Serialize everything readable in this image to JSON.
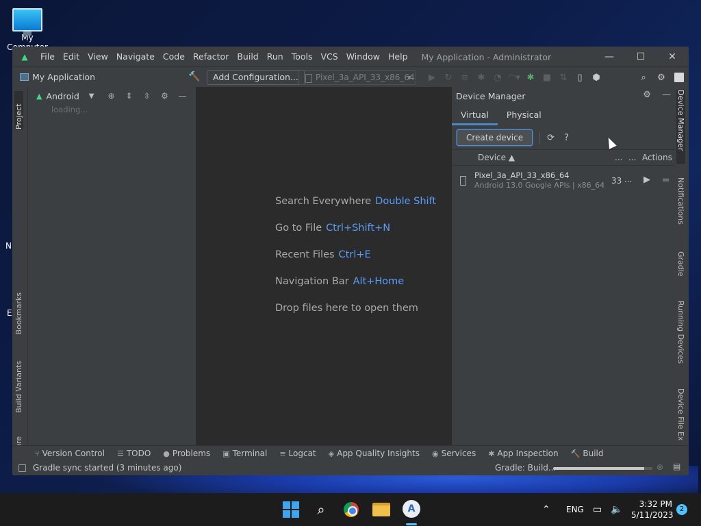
{
  "desktop": {
    "icon_label": "My Computer",
    "partial_labels": [
      "N",
      "E"
    ]
  },
  "window": {
    "title": "My Application - Administrator",
    "menu": [
      "File",
      "Edit",
      "View",
      "Navigate",
      "Code",
      "Refactor",
      "Build",
      "Run",
      "Tools",
      "VCS",
      "Window",
      "Help"
    ],
    "controls": {
      "minimize": "—",
      "maximize": "☐",
      "close": "✕"
    }
  },
  "toolbar": {
    "project_name": "My Application",
    "add_config_label": "Add Configuration...",
    "device_selector": "Pixel_3a_API_33_x86_64"
  },
  "left_tabs": [
    "Project",
    "Bookmarks",
    "Build Variants",
    "Structure"
  ],
  "project_panel": {
    "view_mode": "Android",
    "loading_text": "loading..."
  },
  "editor_hints": [
    {
      "label": "Search Everywhere",
      "key": "Double Shift"
    },
    {
      "label": "Go to File",
      "key": "Ctrl+Shift+N"
    },
    {
      "label": "Recent Files",
      "key": "Ctrl+E"
    },
    {
      "label": "Navigation Bar",
      "key": "Alt+Home"
    },
    {
      "label": "Drop files here to open them",
      "key": ""
    }
  ],
  "device_manager": {
    "title": "Device Manager",
    "tabs": [
      "Virtual",
      "Physical"
    ],
    "active_tab": "Virtual",
    "create_button": "Create device",
    "columns": {
      "device": "Device",
      "api": "...",
      "size": "...",
      "actions": "Actions"
    },
    "devices": [
      {
        "name": "Pixel_3a_API_33_x86_64",
        "description": "Android 13.0 Google APIs | x86_64",
        "api": "33",
        "more": "..."
      }
    ]
  },
  "right_tabs": [
    "Device Manager",
    "Notifications",
    "Gradle",
    "Running Devices",
    "Device File Ex"
  ],
  "bottom_tabs": [
    "Version Control",
    "TODO",
    "Problems",
    "Terminal",
    "Logcat",
    "App Quality Insights",
    "Services",
    "App Inspection",
    "Build"
  ],
  "status_bar": {
    "message": "Gradle sync started (3 minutes ago)",
    "task": "Gradle: Build...",
    "progress": 0.92
  },
  "taskbar": {
    "language": "ENG",
    "time": "3:32 PM",
    "date": "5/11/2023",
    "notification_count": "2"
  },
  "colors": {
    "accent": "#589df6",
    "android_green": "#3ddc84",
    "panel_bg": "#3c3f41",
    "editor_bg": "#2b2b2b"
  }
}
